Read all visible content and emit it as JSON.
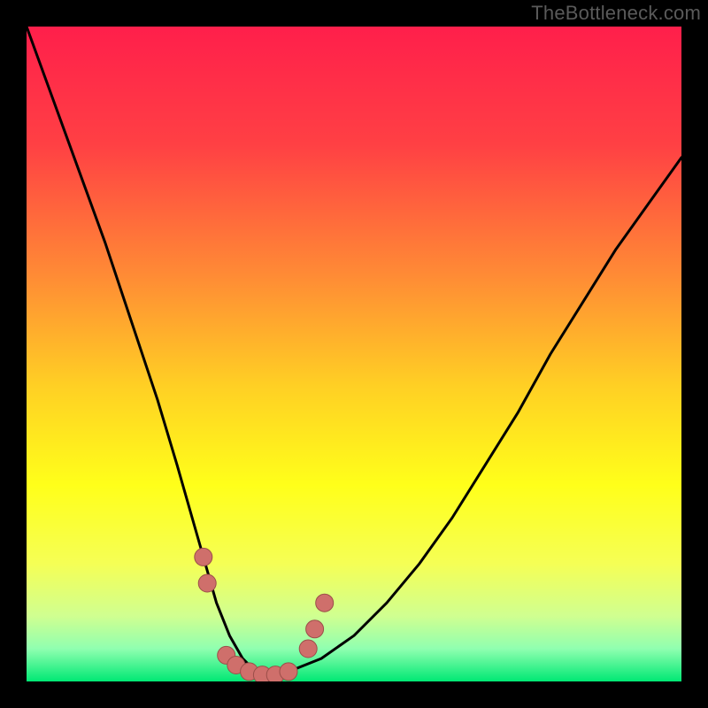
{
  "watermark": "TheBottleneck.com",
  "colors": {
    "frame": "#000000",
    "gradient_stops": [
      {
        "offset": 0.0,
        "color": "#ff1f4b"
      },
      {
        "offset": 0.18,
        "color": "#ff4044"
      },
      {
        "offset": 0.38,
        "color": "#ff8b35"
      },
      {
        "offset": 0.55,
        "color": "#ffd024"
      },
      {
        "offset": 0.7,
        "color": "#ffff1a"
      },
      {
        "offset": 0.82,
        "color": "#f5ff55"
      },
      {
        "offset": 0.9,
        "color": "#d0ff90"
      },
      {
        "offset": 0.95,
        "color": "#90ffb0"
      },
      {
        "offset": 1.0,
        "color": "#00e874"
      }
    ],
    "curve_stroke": "#000000",
    "marker_fill": "#cf6f6b",
    "marker_stroke": "#9b4e49"
  },
  "chart_data": {
    "type": "line",
    "title": "",
    "xlabel": "",
    "ylabel": "",
    "xlim": [
      0,
      100
    ],
    "ylim": [
      0,
      100
    ],
    "x": [
      0,
      4,
      8,
      12,
      16,
      20,
      23,
      25,
      27,
      29,
      31,
      33,
      35,
      37,
      40,
      45,
      50,
      55,
      60,
      65,
      70,
      75,
      80,
      85,
      90,
      95,
      100
    ],
    "values": [
      100,
      89,
      78,
      67,
      55,
      43,
      33,
      26,
      19,
      12,
      7,
      3.5,
      1.5,
      1,
      1.5,
      3.5,
      7,
      12,
      18,
      25,
      33,
      41,
      50,
      58,
      66,
      73,
      80
    ],
    "annotations": {
      "markers": [
        {
          "x": 27.0,
          "y": 19.0
        },
        {
          "x": 27.6,
          "y": 15.0
        },
        {
          "x": 30.5,
          "y": 4.0
        },
        {
          "x": 32.0,
          "y": 2.5
        },
        {
          "x": 34.0,
          "y": 1.5
        },
        {
          "x": 36.0,
          "y": 1.0
        },
        {
          "x": 38.0,
          "y": 1.0
        },
        {
          "x": 40.0,
          "y": 1.5
        },
        {
          "x": 43.0,
          "y": 5.0
        },
        {
          "x": 44.0,
          "y": 8.0
        },
        {
          "x": 45.5,
          "y": 12.0
        }
      ]
    }
  }
}
